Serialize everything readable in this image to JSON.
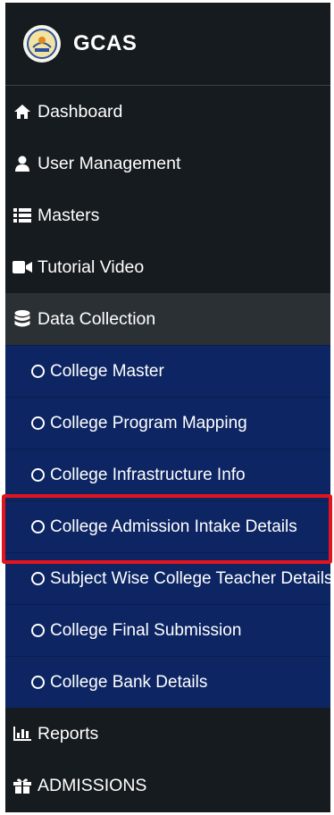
{
  "brand": {
    "name": "GCAS",
    "logo_icon": "college-emblem-icon"
  },
  "nav": [
    {
      "label": "Dashboard",
      "icon": "home-icon"
    },
    {
      "label": "User Management",
      "icon": "user-icon"
    },
    {
      "label": "Masters",
      "icon": "list-icon"
    },
    {
      "label": "Tutorial Video",
      "icon": "video-camera-icon"
    },
    {
      "label": "Data Collection",
      "icon": "database-icon"
    }
  ],
  "data_collection_items": [
    "College Master",
    "College Program Mapping",
    "College Infrastructure Info",
    "College Admission Intake Details",
    "Subject Wise College Teacher Details",
    "College Final Submission",
    "College Bank Details"
  ],
  "nav_bottom": [
    {
      "label": "Reports",
      "icon": "bar-chart-icon"
    },
    {
      "label": "ADMISSIONS",
      "icon": "gift-icon"
    }
  ],
  "colors": {
    "sidebar_bg": "#161b1f",
    "active_bg": "#2b3035",
    "submenu_bg": "#0d2563",
    "highlight": "#e5131d"
  }
}
